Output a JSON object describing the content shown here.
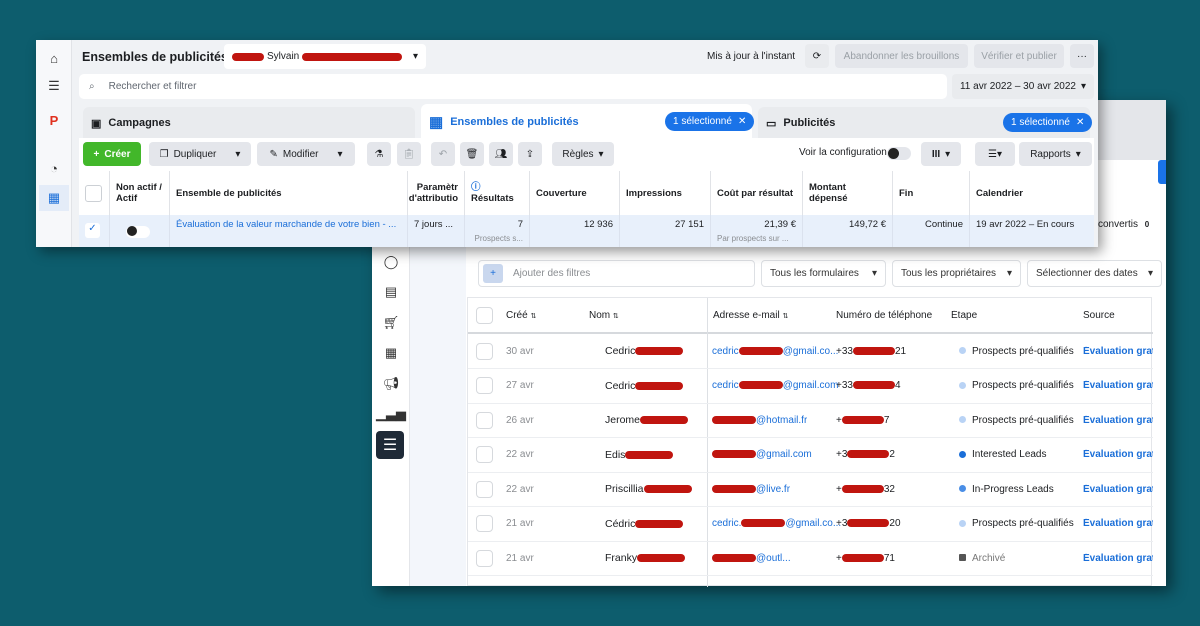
{
  "colors": {
    "background": "#0d5d6d",
    "accent": "#1a73e8",
    "create": "#42b72a",
    "redaction": "#c0150f"
  },
  "back": {
    "sidebar_icons": [
      "chat-icon",
      "pages-icon",
      "cart-icon",
      "table-icon",
      "megaphone-icon",
      "chart-icon",
      "menu-icon"
    ],
    "partial_label": "convertis",
    "partial_count": "0",
    "filters": {
      "add_placeholder": "Ajouter des filtres",
      "forms": "Tous les formulaires",
      "owners": "Tous les propriétaires",
      "dates": "Sélectionner des dates"
    },
    "columns": [
      "Créé",
      "Nom",
      "Adresse e-mail",
      "Numéro de téléphone",
      "Étape",
      "Source"
    ],
    "rows": [
      {
        "created": "30 avr",
        "name": "Cedric",
        "email_pre": "cedric",
        "email_post": "@gmail.co...",
        "phone_pre": "+33",
        "phone_post": "21",
        "stage": "Prospects pré-qualifiés",
        "stage_color": "#b9d3f5",
        "source": "Évaluation gratu"
      },
      {
        "created": "27 avr",
        "name": "Cedric",
        "email_pre": "cedric",
        "email_post": "@gmail.com",
        "phone_pre": "+33",
        "phone_post": "4",
        "stage": "Prospects pré-qualifiés",
        "stage_color": "#b9d3f5",
        "source": "Évaluation gratu"
      },
      {
        "created": "26 avr",
        "name": "Jerome",
        "email_pre": "",
        "email_post": "@hotmail.fr",
        "phone_pre": "+",
        "phone_post": "7",
        "stage": "Prospects pré-qualifiés",
        "stage_color": "#b9d3f5",
        "source": "Évaluation gratu"
      },
      {
        "created": "22 avr",
        "name": "Edis",
        "email_pre": "",
        "email_post": "@gmail.com",
        "phone_pre": "+3",
        "phone_post": "2",
        "stage": "Interested Leads",
        "stage_color": "#1a6ed8",
        "source": "Évaluation gratu"
      },
      {
        "created": "22 avr",
        "name": "Priscillia",
        "email_pre": "",
        "email_post": "@live.fr",
        "phone_pre": "+",
        "phone_post": "32",
        "stage": "In-Progress Leads",
        "stage_color": "#4a8ee6",
        "source": "Évaluation gratu"
      },
      {
        "created": "21 avr",
        "name": "Cédric",
        "email_pre": "cedric.",
        "email_post": "@gmail.co...",
        "phone_pre": "+3",
        "phone_post": "20",
        "stage": "Prospects pré-qualifiés",
        "stage_color": "#b9d3f5",
        "source": "Évaluation gratu"
      },
      {
        "created": "21 avr",
        "name": "Franky",
        "email_pre": "",
        "email_post": "@outl...",
        "phone_pre": "+",
        "phone_post": "71",
        "stage": "Archivé",
        "stage_color": "#555",
        "source": "Évaluation gratu"
      }
    ]
  },
  "front": {
    "title": "Ensembles de publicités",
    "account": "Sylvain",
    "updated": "Mis à jour à l'instant",
    "discard": "Abandonner les brouillons",
    "publish": "Vérifier et publier",
    "more": "···",
    "search_placeholder": "Rechercher et filtrer",
    "date_range": "11 avr 2022 – 30 avr 2022",
    "tabs": {
      "campaigns": "Campagnes",
      "adsets": "Ensembles de publicités",
      "ads": "Publicités",
      "selected": "1 sélectionné"
    },
    "toolbar": {
      "create": "Créer",
      "duplicate": "Dupliquer",
      "edit": "Modifier",
      "rules": "Règles",
      "view_config": "Voir la configuration",
      "reports": "Rapports"
    },
    "columns": {
      "toggle": "Non actif / Actif",
      "name": "Ensemble de publicités",
      "attribution": "Paramètr d'attributio",
      "results": "Résultats",
      "reach": "Couverture",
      "impressions": "Impressions",
      "cost": "Coût par résultat",
      "spent": "Montant dépensé",
      "end": "Fin",
      "schedule": "Calendrier"
    },
    "row": {
      "name": "Évaluation de la valeur marchande de votre bien - ...",
      "attribution": "7 jours ...",
      "results": "7",
      "results_sub": "Prospects s...",
      "reach": "12 936",
      "impressions": "27 151",
      "cost": "21,39 €",
      "cost_sub": "Par prospects sur ...",
      "spent": "149,72 €",
      "end": "Continue",
      "schedule": "19 avr 2022 – En cours"
    }
  }
}
